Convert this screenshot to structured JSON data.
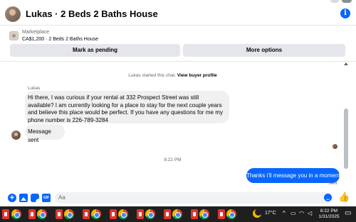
{
  "header": {
    "title": "Lukas · 2 Beds 2 Baths House",
    "info_icon": "info-icon"
  },
  "listing": {
    "category": "Marketplace",
    "subtitle": "CA$1,200 · 2 Beds 2 Baths House",
    "mark_pending_label": "Mark as pending",
    "more_options_label": "More options"
  },
  "chat": {
    "system_text": "Lukas started this chat.",
    "system_link": "View buyer profile",
    "sender_name": "Lukas",
    "incoming_message": "Hi there, I was curious if your rental at 332 Prospect Street was still available? I am currently looking for a place to stay for the next couple years and believe this place would be perfect. If you have any questions for me my phone number is 226-789-3284",
    "incoming_status": "Message sent",
    "timestamp": "8:22 PM",
    "outgoing_message": "Thanks i’ll message you in a moment",
    "outgoing_status": "Sent"
  },
  "composer": {
    "placeholder": "Aa"
  },
  "taskbar": {
    "weather": "17°C",
    "time": "8:22 PM",
    "date": "1/31/2025"
  },
  "colors": {
    "accent": "#0866ff",
    "bubble_in": "#f0f0f0",
    "taskbar": "#1f1f1f"
  }
}
